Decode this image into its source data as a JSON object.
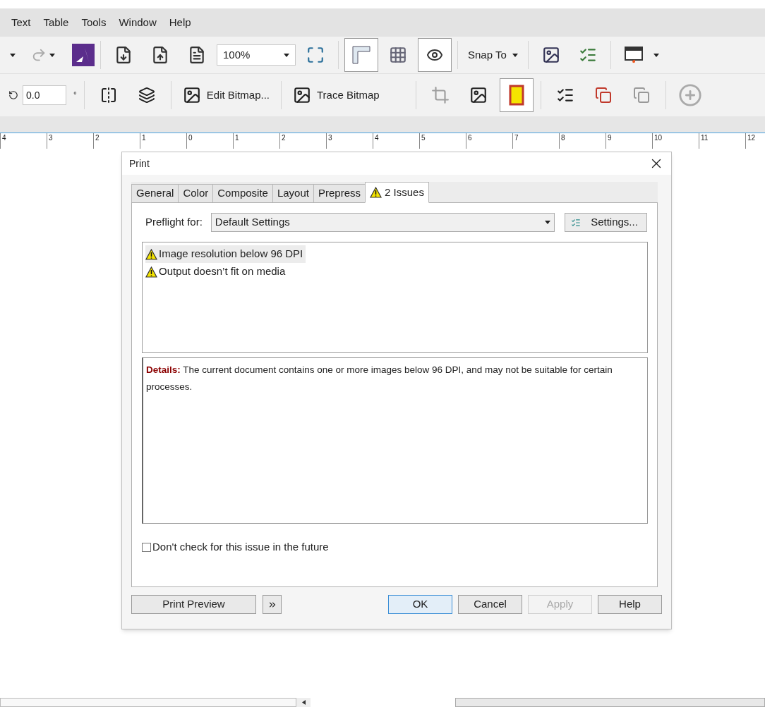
{
  "menu_bar": {
    "items": [
      "Text",
      "Table",
      "Tools",
      "Window",
      "Help"
    ]
  },
  "standard_toolbar": {
    "zoom": "100%",
    "snap": "Snap To",
    "view_toggles": [
      {
        "selected": true
      },
      {
        "selected": false
      },
      {
        "selected": true
      }
    ]
  },
  "property_bar": {
    "angle": "0.0",
    "degree": "°",
    "edit_bitmap": "Edit Bitmap...",
    "trace_bitmap": "Trace Bitmap",
    "frame_toggle": {
      "selected": true
    }
  },
  "ruler": {
    "labels": [
      "4",
      "3",
      "2",
      "1",
      "0",
      "1",
      "2",
      "3",
      "4",
      "5",
      "6",
      "7",
      "8",
      "9",
      "10",
      "11",
      "12"
    ]
  },
  "dialog": {
    "title": "Print",
    "tabs": [
      {
        "label": "General",
        "selected": false,
        "warning": false
      },
      {
        "label": "Color",
        "selected": false,
        "warning": false
      },
      {
        "label": "Composite",
        "selected": false,
        "warning": false
      },
      {
        "label": "Layout",
        "selected": false,
        "warning": false
      },
      {
        "label": "Prepress",
        "selected": false,
        "warning": false
      },
      {
        "label": "2 Issues",
        "selected": true,
        "warning": true
      }
    ],
    "preflight_label": "Preflight for:",
    "preflight_value": "Default Settings",
    "settings_button": "Settings...",
    "issues": [
      {
        "text": "Image resolution below 96 DPI",
        "selected": true
      },
      {
        "text": "Output doesn’t fit on media",
        "selected": false
      }
    ],
    "details": "**Details:** The current document contains one or more images below 96 DPI, and may not be suitable for certain processes.",
    "dont_check": {
      "label": "Don't check for this issue in the future",
      "checked": false
    },
    "print_preview": "Print Preview",
    "buttons": [
      {
        "label": "OK",
        "default": true,
        "disabled": false
      },
      {
        "label": "Cancel",
        "default": false,
        "disabled": false
      },
      {
        "label": "Apply",
        "default": false,
        "disabled": true
      },
      {
        "label": "Help",
        "default": false,
        "disabled": false
      }
    ]
  }
}
